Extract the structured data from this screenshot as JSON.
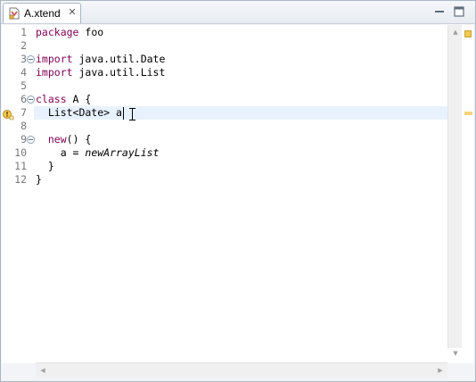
{
  "tab": {
    "title": "A.xtend",
    "close_glyph": "✕"
  },
  "window_controls": {
    "minimize_icon": "minimize-icon",
    "maximize_icon": "maximize-icon"
  },
  "editor": {
    "lines": [
      {
        "num": "1",
        "parts": [
          [
            "kw",
            "package"
          ],
          [
            "t",
            " foo"
          ]
        ]
      },
      {
        "num": "2",
        "parts": []
      },
      {
        "num": "3",
        "parts": [
          [
            "kw",
            "import"
          ],
          [
            "t",
            " java.util.Date"
          ]
        ],
        "fold": true
      },
      {
        "num": "4",
        "parts": [
          [
            "kw",
            "import"
          ],
          [
            "t",
            " java.util.List"
          ]
        ]
      },
      {
        "num": "5",
        "parts": []
      },
      {
        "num": "6",
        "parts": [
          [
            "kw",
            "class"
          ],
          [
            "t",
            " A {"
          ]
        ],
        "fold": true
      },
      {
        "num": "7",
        "parts": [
          [
            "t",
            "  List<Date> a"
          ]
        ],
        "current": true,
        "warning": true
      },
      {
        "num": "8",
        "parts": []
      },
      {
        "num": "9",
        "parts": [
          [
            "t",
            "  "
          ],
          [
            "kw",
            "new"
          ],
          [
            "t",
            "() {"
          ]
        ],
        "fold": true
      },
      {
        "num": "10",
        "parts": [
          [
            "t",
            "    a = "
          ],
          [
            "it",
            "newArrayList"
          ]
        ]
      },
      {
        "num": "11",
        "parts": [
          [
            "t",
            "  }"
          ]
        ]
      },
      {
        "num": "12",
        "parts": [
          [
            "t",
            "}"
          ]
        ]
      }
    ]
  },
  "colors": {
    "keyword": "#7f0055",
    "current_line": "#e8f2fe",
    "line_number": "#787878",
    "warning": "#f2c94c"
  }
}
